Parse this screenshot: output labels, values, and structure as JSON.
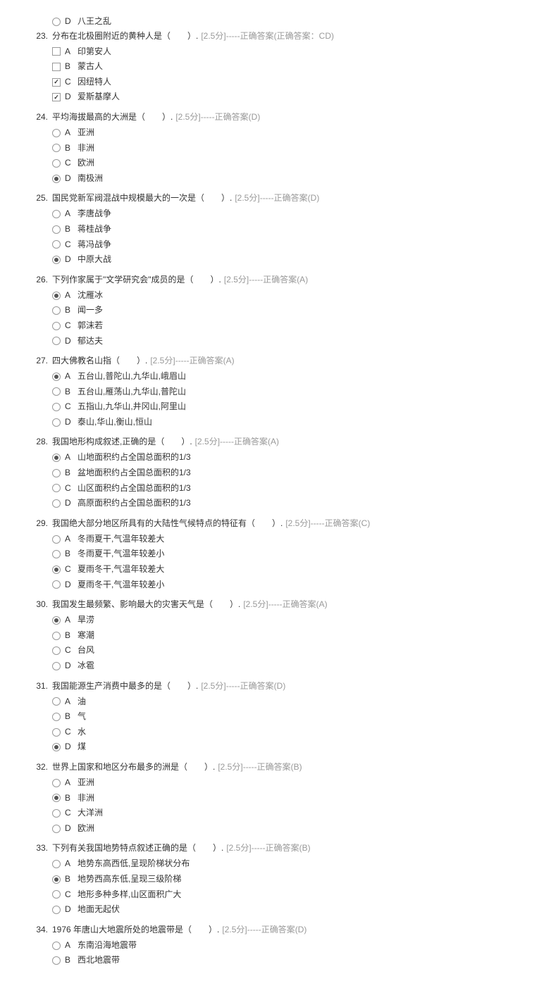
{
  "orphan": {
    "letter": "D",
    "text": "八王之乱",
    "type": "radio",
    "selected": false
  },
  "questions": [
    {
      "num": "23.",
      "stem": "分布在北极圈附近的黄种人是（　　）.",
      "meta": "[2.5分]-----正确答案(正确答案：CD)",
      "type": "checkbox",
      "options": [
        {
          "letter": "A",
          "text": "印第安人",
          "selected": false
        },
        {
          "letter": "B",
          "text": "蒙古人",
          "selected": false
        },
        {
          "letter": "C",
          "text": "因纽特人",
          "selected": true
        },
        {
          "letter": "D",
          "text": "爱斯基摩人",
          "selected": true
        }
      ]
    },
    {
      "num": "24.",
      "stem": "平均海拔最高的大洲是（　　）.",
      "meta": "[2.5分]-----正确答案(D)",
      "type": "radio",
      "options": [
        {
          "letter": "A",
          "text": "亚洲",
          "selected": false
        },
        {
          "letter": "B",
          "text": "非洲",
          "selected": false
        },
        {
          "letter": "C",
          "text": "欧洲",
          "selected": false
        },
        {
          "letter": "D",
          "text": "南极洲",
          "selected": true
        }
      ]
    },
    {
      "num": "25.",
      "stem": "国民党新军阀混战中规模最大的一次是（　　）.",
      "meta": "[2.5分]-----正确答案(D)",
      "type": "radio",
      "options": [
        {
          "letter": "A",
          "text": "李唐战争",
          "selected": false
        },
        {
          "letter": "B",
          "text": "蒋桂战争",
          "selected": false
        },
        {
          "letter": "C",
          "text": "蒋冯战争",
          "selected": false
        },
        {
          "letter": "D",
          "text": "中原大战",
          "selected": true
        }
      ]
    },
    {
      "num": "26.",
      "stem": "下列作家属于\"文学研究会\"成员的是（　　）.",
      "meta": "[2.5分]-----正确答案(A)",
      "type": "radio",
      "options": [
        {
          "letter": "A",
          "text": "沈雁冰",
          "selected": true
        },
        {
          "letter": "B",
          "text": "闻一多",
          "selected": false
        },
        {
          "letter": "C",
          "text": "郭沫若",
          "selected": false
        },
        {
          "letter": "D",
          "text": "郁达夫",
          "selected": false
        }
      ]
    },
    {
      "num": "27.",
      "stem": "四大佛教名山指（　　）.",
      "meta": "[2.5分]-----正确答案(A)",
      "type": "radio",
      "options": [
        {
          "letter": "A",
          "text": "五台山,普陀山,九华山,峨眉山",
          "selected": true
        },
        {
          "letter": "B",
          "text": "五台山,雁荡山,九华山,普陀山",
          "selected": false
        },
        {
          "letter": "C",
          "text": "五指山,九华山,井冈山,阿里山",
          "selected": false
        },
        {
          "letter": "D",
          "text": "泰山,华山,衡山,恒山",
          "selected": false
        }
      ]
    },
    {
      "num": "28.",
      "stem": "我国地形构成叙述,正确的是（　　）.",
      "meta": "[2.5分]-----正确答案(A)",
      "type": "radio",
      "options": [
        {
          "letter": "A",
          "text": "山地面积约占全国总面积的1/3",
          "selected": true
        },
        {
          "letter": "B",
          "text": "盆地面积约占全国总面积的1/3",
          "selected": false
        },
        {
          "letter": "C",
          "text": "山区面积约占全国总面积的1/3",
          "selected": false
        },
        {
          "letter": "D",
          "text": "高原面积约占全国总面积的1/3",
          "selected": false
        }
      ]
    },
    {
      "num": "29.",
      "stem": "我国绝大部分地区所具有的大陆性气候特点的特征有（　　）.",
      "meta": "[2.5分]-----正确答案(C)",
      "type": "radio",
      "options": [
        {
          "letter": "A",
          "text": "冬雨夏干,气温年较差大",
          "selected": false
        },
        {
          "letter": "B",
          "text": "冬雨夏干,气温年较差小",
          "selected": false
        },
        {
          "letter": "C",
          "text": "夏雨冬干,气温年较差大",
          "selected": true
        },
        {
          "letter": "D",
          "text": "夏雨冬干,气温年较差小",
          "selected": false
        }
      ]
    },
    {
      "num": "30.",
      "stem": "我国发生最频繁、影响最大的灾害天气是（　　）.",
      "meta": "[2.5分]-----正确答案(A)",
      "type": "radio",
      "options": [
        {
          "letter": "A",
          "text": "旱涝",
          "selected": true
        },
        {
          "letter": "B",
          "text": "寒潮",
          "selected": false
        },
        {
          "letter": "C",
          "text": "台风",
          "selected": false
        },
        {
          "letter": "D",
          "text": "冰雹",
          "selected": false
        }
      ]
    },
    {
      "num": "31.",
      "stem": "我国能源生产消费中最多的是（　　）.",
      "meta": "[2.5分]-----正确答案(D)",
      "type": "radio",
      "options": [
        {
          "letter": "A",
          "text": "油",
          "selected": false
        },
        {
          "letter": "B",
          "text": "气",
          "selected": false
        },
        {
          "letter": "C",
          "text": "水",
          "selected": false
        },
        {
          "letter": "D",
          "text": "煤",
          "selected": true
        }
      ]
    },
    {
      "num": "32.",
      "stem": "世界上国家和地区分布最多的洲是（　　）.",
      "meta": "[2.5分]-----正确答案(B)",
      "type": "radio",
      "options": [
        {
          "letter": "A",
          "text": "亚洲",
          "selected": false
        },
        {
          "letter": "B",
          "text": "非洲",
          "selected": true
        },
        {
          "letter": "C",
          "text": "大洋洲",
          "selected": false
        },
        {
          "letter": "D",
          "text": "欧洲",
          "selected": false
        }
      ]
    },
    {
      "num": "33.",
      "stem": "下列有关我国地势特点叙述正确的是（　　）.",
      "meta": "[2.5分]-----正确答案(B)",
      "type": "radio",
      "options": [
        {
          "letter": "A",
          "text": "地势东高西低,呈现阶梯状分布",
          "selected": false
        },
        {
          "letter": "B",
          "text": "地势西高东低,呈现三级阶梯",
          "selected": true
        },
        {
          "letter": "C",
          "text": "地形多种多样,山区面积广大",
          "selected": false
        },
        {
          "letter": "D",
          "text": "地面无起伏",
          "selected": false
        }
      ]
    },
    {
      "num": "34.",
      "stem": "1976 年唐山大地震所处的地震带是（　　）.",
      "meta": "[2.5分]-----正确答案(D)",
      "type": "radio",
      "options": [
        {
          "letter": "A",
          "text": "东南沿海地震带",
          "selected": false
        },
        {
          "letter": "B",
          "text": "西北地震带",
          "selected": false
        }
      ]
    }
  ]
}
